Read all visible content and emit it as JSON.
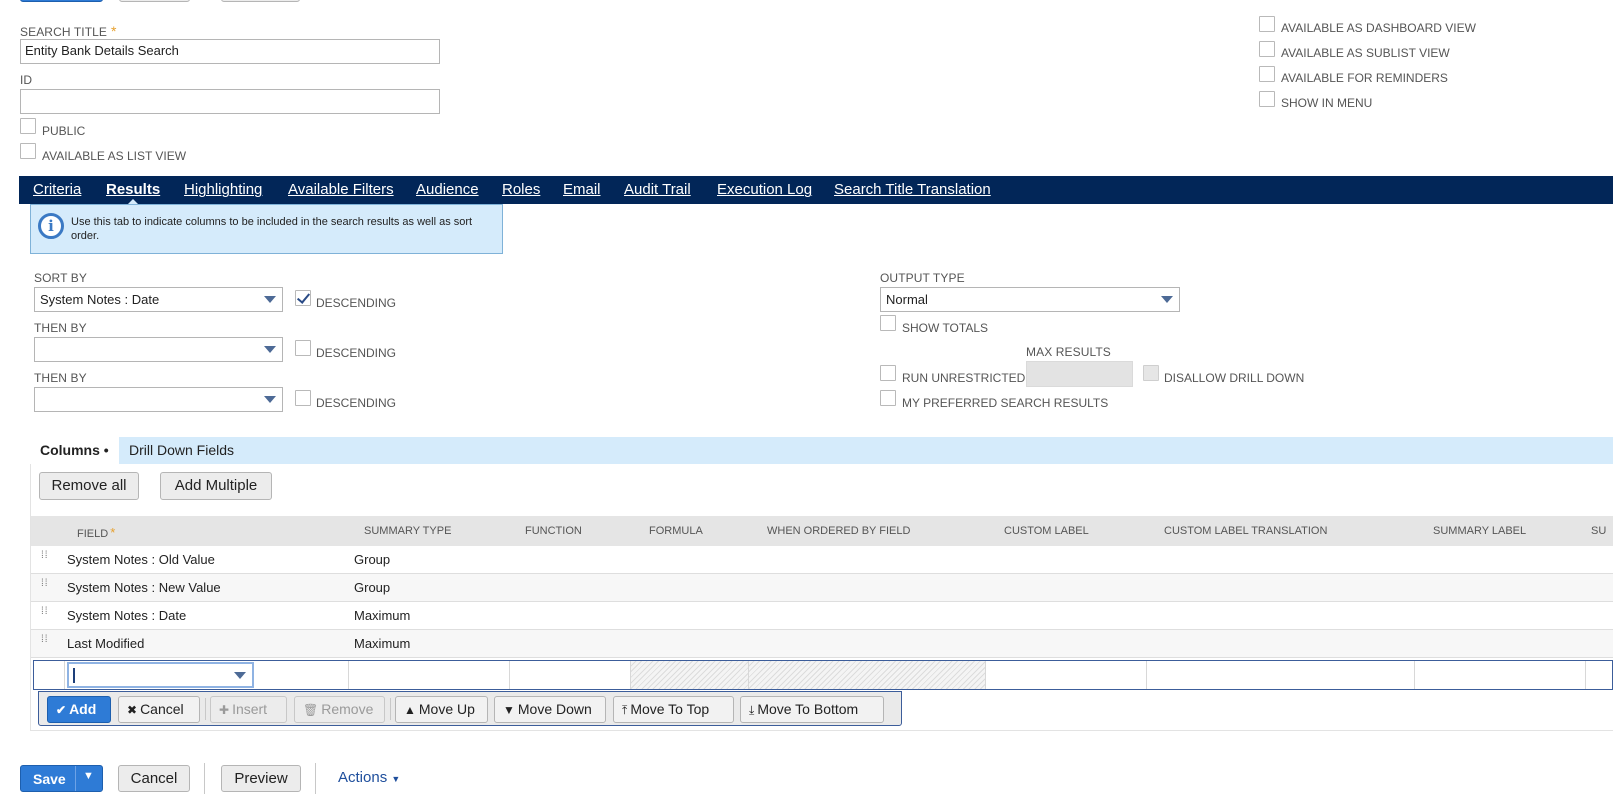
{
  "form": {
    "search_title_label": "SEARCH TITLE",
    "search_title_required": "*",
    "search_title_value": "Entity Bank Details Search",
    "id_label": "ID",
    "id_value": "",
    "public_label": "PUBLIC",
    "list_view_label": "AVAILABLE AS LIST VIEW",
    "dashboard_view_label": "AVAILABLE AS DASHBOARD VIEW",
    "sublist_view_label": "AVAILABLE AS SUBLIST VIEW",
    "reminders_label": "AVAILABLE FOR REMINDERS",
    "show_in_menu_label": "SHOW IN MENU"
  },
  "tabs": [
    {
      "label": "Criteria",
      "active": false
    },
    {
      "label": "Results",
      "active": true
    },
    {
      "label": "Highlighting",
      "active": false
    },
    {
      "label": "Available Filters",
      "active": false
    },
    {
      "label": "Audience",
      "active": false
    },
    {
      "label": "Roles",
      "active": false
    },
    {
      "label": "Email",
      "active": false
    },
    {
      "label": "Audit Trail",
      "active": false
    },
    {
      "label": "Execution Log",
      "active": false
    },
    {
      "label": "Search Title Translation",
      "active": false
    }
  ],
  "info": {
    "text": "Use this tab to indicate columns to be included in the search results as well as sort order."
  },
  "sort": {
    "sort_by_label": "SORT BY",
    "sort_by_value": "System Notes : Date",
    "descending_label": "DESCENDING",
    "sort_descending": true,
    "then_by_label": "THEN BY",
    "then_by_1_value": "",
    "then_by_2_value": ""
  },
  "output": {
    "output_type_label": "OUTPUT TYPE",
    "output_type_value": "Normal",
    "show_totals_label": "SHOW TOTALS",
    "max_results_label": "MAX RESULTS",
    "run_unrestricted_label": "RUN UNRESTRICTED",
    "disallow_drill_down_label": "DISALLOW DRILL DOWN",
    "preferred_results_label": "MY PREFERRED SEARCH RESULTS"
  },
  "subtabs": {
    "columns_label": "Columns",
    "columns_marker": "•",
    "drill_down_label": "Drill Down Fields"
  },
  "column_buttons": {
    "remove_all": "Remove all",
    "add_multiple": "Add Multiple"
  },
  "grid": {
    "headers": {
      "field": "FIELD",
      "field_required": "*",
      "summary_type": "SUMMARY TYPE",
      "function": "FUNCTION",
      "formula": "FORMULA",
      "when_ordered": "WHEN ORDERED BY FIELD",
      "custom_label": "CUSTOM LABEL",
      "custom_label_translation": "CUSTOM LABEL TRANSLATION",
      "summary_label": "SUMMARY LABEL",
      "truncated": "SU"
    },
    "rows": [
      {
        "field": "System Notes : Old Value",
        "summary": "Group"
      },
      {
        "field": "System Notes : New Value",
        "summary": "Group"
      },
      {
        "field": "System Notes : Date",
        "summary": "Maximum"
      },
      {
        "field": "Last Modified",
        "summary": "Maximum"
      }
    ]
  },
  "edit_buttons": {
    "add": "Add",
    "cancel": "Cancel",
    "insert": "Insert",
    "remove": "Remove",
    "move_up": "Move Up",
    "move_down": "Move Down",
    "move_to_top": "Move To Top",
    "move_to_bottom": "Move To Bottom"
  },
  "footer": {
    "save": "Save",
    "cancel": "Cancel",
    "preview": "Preview",
    "actions": "Actions"
  },
  "colors": {
    "tab_bar": "#022658",
    "info_bg": "#d5ebfb",
    "primary_button": "#2e7bd6",
    "link": "#1e4e9c"
  }
}
